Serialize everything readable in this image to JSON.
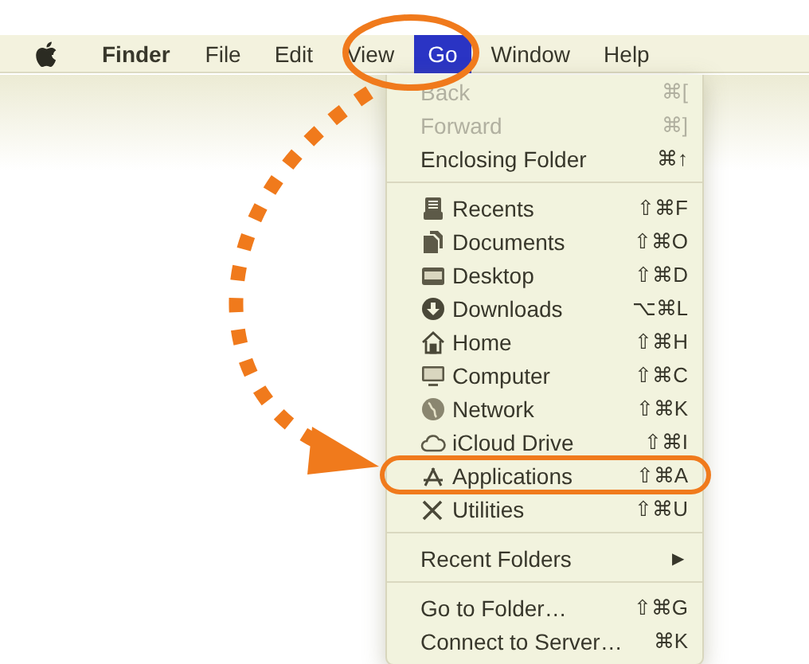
{
  "menubar": [
    {
      "label": "Finder",
      "selected": false,
      "bold": true
    },
    {
      "label": "File",
      "selected": false,
      "bold": false
    },
    {
      "label": "Edit",
      "selected": false,
      "bold": false
    },
    {
      "label": "View",
      "selected": false,
      "bold": false
    },
    {
      "label": "Go",
      "selected": true,
      "bold": false
    },
    {
      "label": "Window",
      "selected": false,
      "bold": false
    },
    {
      "label": "Help",
      "selected": false,
      "bold": false
    }
  ],
  "menu": [
    {
      "kind": "item",
      "label": "Back",
      "shortcut": "⌘[",
      "disabled": true
    },
    {
      "kind": "item",
      "label": "Forward",
      "shortcut": "⌘]",
      "disabled": true
    },
    {
      "kind": "item",
      "label": "Enclosing Folder",
      "shortcut": "⌘↑",
      "disabled": false
    },
    {
      "kind": "separator"
    },
    {
      "kind": "place",
      "label": "Recents",
      "shortcut": "⇧⌘F",
      "disabled": false
    },
    {
      "kind": "place",
      "label": "Documents",
      "shortcut": "⇧⌘O",
      "disabled": false
    },
    {
      "kind": "place",
      "label": "Desktop",
      "shortcut": "⇧⌘D",
      "disabled": false
    },
    {
      "kind": "place",
      "label": "Downloads",
      "shortcut": "⌥⌘L",
      "disabled": false
    },
    {
      "kind": "place",
      "label": "Home",
      "shortcut": "⇧⌘H",
      "disabled": false
    },
    {
      "kind": "place",
      "label": "Computer",
      "shortcut": "⇧⌘C",
      "disabled": false
    },
    {
      "kind": "place",
      "label": "Network",
      "shortcut": "⇧⌘K",
      "disabled": false
    },
    {
      "kind": "place",
      "label": "iCloud Drive",
      "shortcut": "⇧⌘I",
      "disabled": false
    },
    {
      "kind": "place",
      "label": "Applications",
      "shortcut": "⇧⌘A",
      "disabled": false
    },
    {
      "kind": "place",
      "label": "Utilities",
      "shortcut": "⇧⌘U",
      "disabled": false
    },
    {
      "kind": "separator"
    },
    {
      "kind": "submenu",
      "label": "Recent Folders",
      "shortcut": "▶",
      "disabled": false
    },
    {
      "kind": "separator"
    },
    {
      "kind": "item",
      "label": "Go to Folder…",
      "shortcut": "⇧⌘G",
      "disabled": false
    },
    {
      "kind": "item",
      "label": "Connect to Server…",
      "shortcut": "⌘K",
      "disabled": false
    }
  ]
}
